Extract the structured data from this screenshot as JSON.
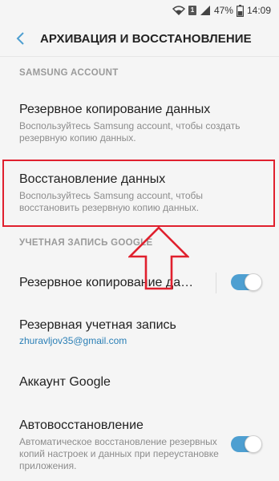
{
  "status_bar": {
    "battery": "47%",
    "time": "14:09",
    "sim_label": "1"
  },
  "app_bar": {
    "title": "АРХИВАЦИЯ И ВОССТАНОВЛЕНИЕ"
  },
  "sections": {
    "samsung": "SAMSUNG ACCOUNT",
    "google": "УЧЕТНАЯ ЗАПИСЬ GOOGLE"
  },
  "items": {
    "samsung_backup": {
      "title": "Резервное копирование данных",
      "desc": "Воспользуйтесь Samsung account, чтобы создать резервную копию данных."
    },
    "samsung_restore": {
      "title": "Восстановление данных",
      "desc": "Воспользуйтесь Samsung account, чтобы восстановить резервную копию данных."
    },
    "google_backup": {
      "title": "Резервное копирование да…",
      "toggle_on": true
    },
    "backup_account": {
      "title": "Резервная учетная запись",
      "value": "zhuravljov35@gmail.com"
    },
    "google_account": {
      "title": "Аккаунт Google"
    },
    "auto_restore": {
      "title": "Автовосстановление",
      "desc": "Автоматическое восстановление резервных копий настроек и данных при переустановке приложения.",
      "toggle_on": true
    }
  },
  "colors": {
    "accent": "#4e9fd1",
    "highlight": "#e0202e",
    "link": "#2a7fb6"
  },
  "icons": [
    "wifi-icon",
    "sim-icon",
    "signal-icon",
    "battery-icon",
    "back-chevron-icon"
  ]
}
